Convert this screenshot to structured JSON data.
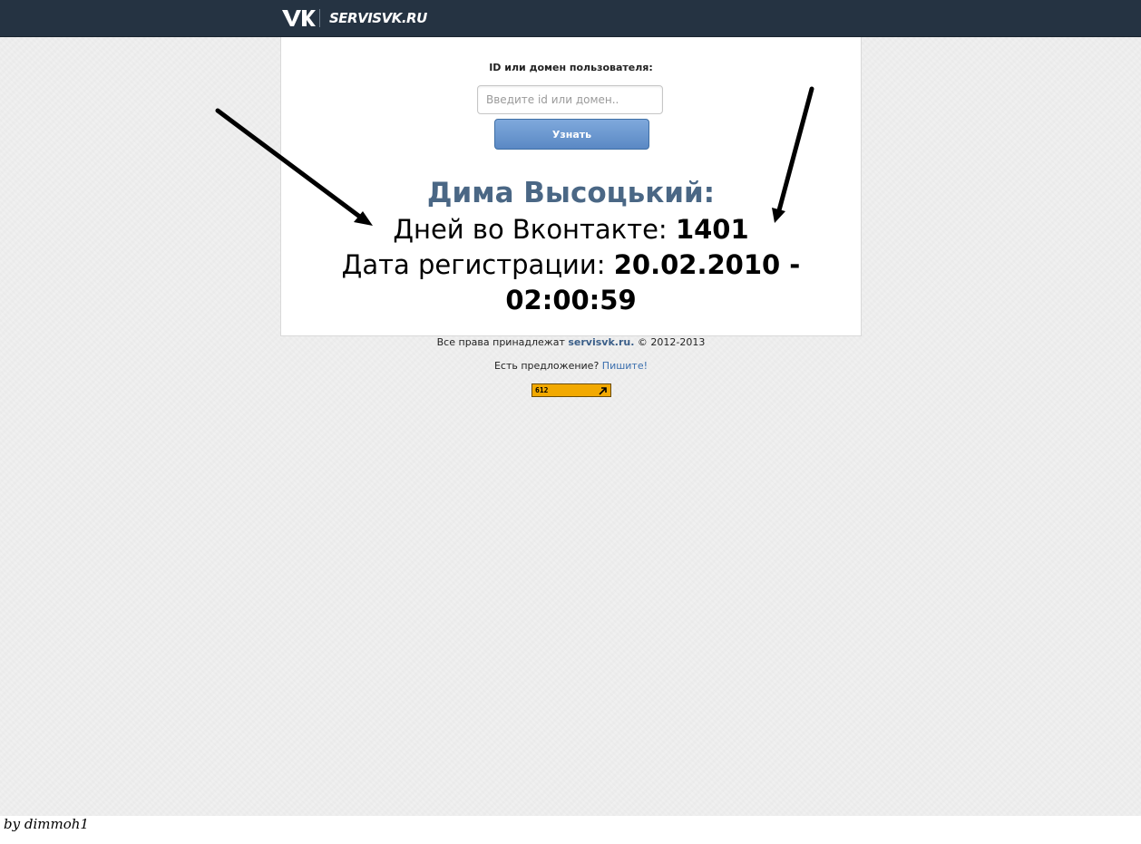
{
  "header": {
    "site_name": "SERVISVK.RU",
    "logo_icon": "vk-logo-icon"
  },
  "form": {
    "label": "ID или домен пользователя:",
    "input_placeholder": "Введите id или домен..",
    "input_value": "",
    "submit_label": "Узнать"
  },
  "result": {
    "name": "Дима Высоцький:",
    "days_label": "Дней во Вконтакте: ",
    "days_value": "1401",
    "reg_label": "Дата регистрации: ",
    "reg_date": "20.02.2010 -",
    "reg_time": "02:00:59"
  },
  "footer": {
    "copyright_prefix": "Все права принадлежат ",
    "copyright_site": "servisvk.ru.",
    "copyright_suffix": " © 2012-2013",
    "offer_prefix": "Есть предложение? ",
    "offer_link": "Пишите!",
    "counter_value": "612"
  },
  "annotation": {
    "signature": "by dimmoh1"
  },
  "colors": {
    "header_bg": "#253342",
    "name_color": "#4a6785",
    "button_color": "#5a88c4",
    "counter_color": "#f2a900"
  }
}
